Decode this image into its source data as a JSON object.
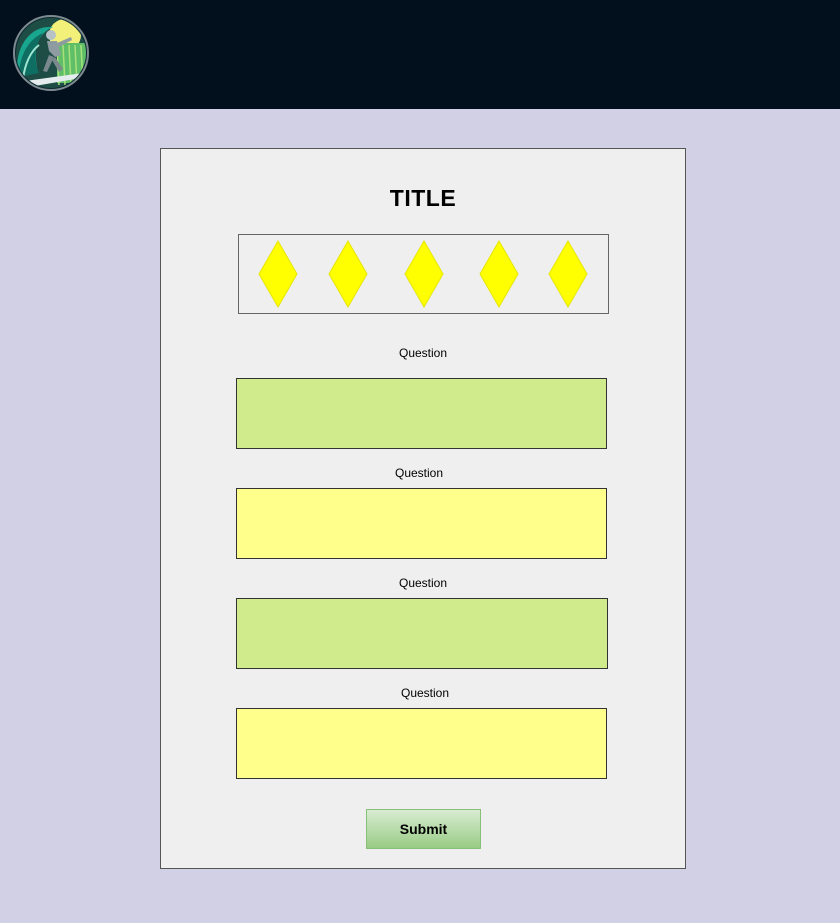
{
  "header": {
    "logo_icon": "surfer-logo-icon",
    "bg_color": "#02101e"
  },
  "form": {
    "title": "TITLE",
    "rating": {
      "max": 5,
      "icon": "diamond-icon",
      "color": "#ffff00"
    },
    "questions": [
      {
        "label": "Question",
        "color": "#d0eb8b"
      },
      {
        "label": "Question",
        "color": "#ffff8b"
      },
      {
        "label": "Question",
        "color": "#d0eb8b"
      },
      {
        "label": "Question",
        "color": "#ffff8b"
      }
    ],
    "submit_label": "Submit"
  }
}
